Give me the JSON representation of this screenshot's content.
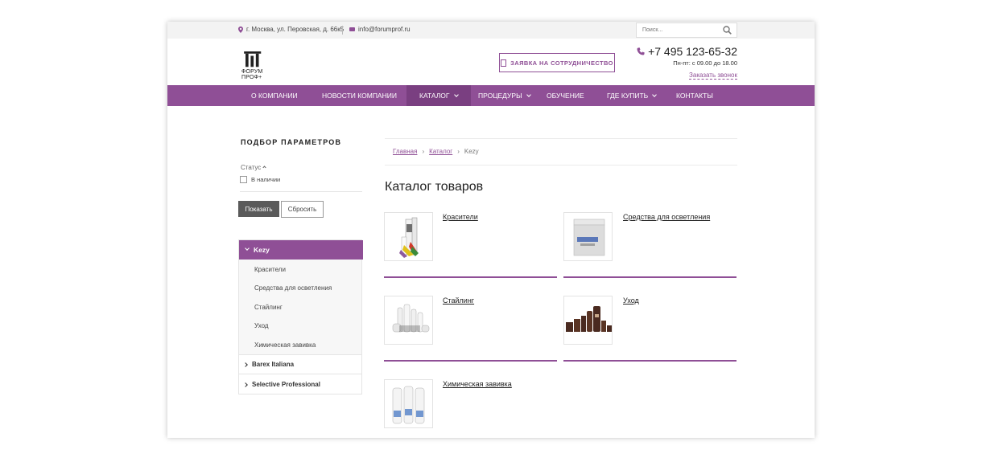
{
  "colors": {
    "brand": "#8f4f96",
    "brand_dark": "#7a3f81",
    "button_dark": "#5a5a5a"
  },
  "topbar": {
    "address": "г. Москва, ул. Перовская, д. 66к5",
    "email": "info@forumprof.ru",
    "search_placeholder": "Поиск..."
  },
  "header": {
    "logo_line1": "ФОРУМ",
    "logo_line2": "ПРОФ+",
    "coop_button": "ЗАЯВКА НА СОТРУДНИЧЕСТВО",
    "phone": "+7 495 123-65-32",
    "hours": "Пн-пт: с 09.00 до 18.00",
    "callback": "Заказать звонок"
  },
  "nav": {
    "items": [
      {
        "label": "О компании"
      },
      {
        "label": "Новости компании"
      },
      {
        "label": "Каталог"
      },
      {
        "label": "Процедуры"
      },
      {
        "label": "Обучение"
      },
      {
        "label": "Где купить"
      },
      {
        "label": "Контакты"
      }
    ]
  },
  "filter": {
    "title": "ПОДБОР ПАРАМЕТРОВ",
    "status_label": "Статус",
    "in_stock": "В наличии",
    "show_button": "Показать",
    "reset_button": "Сбросить"
  },
  "categories": {
    "active": "Kezy",
    "sub_items": [
      "Красители",
      "Средства для осветления",
      "Стайлинг",
      "Уход",
      "Химическая завивка"
    ],
    "brands": [
      "Barex Italiana",
      "Selective Professional"
    ]
  },
  "breadcrumb": {
    "home": "Главная",
    "catalog": "Каталог",
    "current": "Kezy",
    "separator": "›"
  },
  "main": {
    "title": "Каталог товаров",
    "products": [
      {
        "name": "Красители"
      },
      {
        "name": "Средства для осветления"
      },
      {
        "name": "Стайлинг"
      },
      {
        "name": "Уход"
      },
      {
        "name": "Химическая завивка"
      }
    ]
  }
}
